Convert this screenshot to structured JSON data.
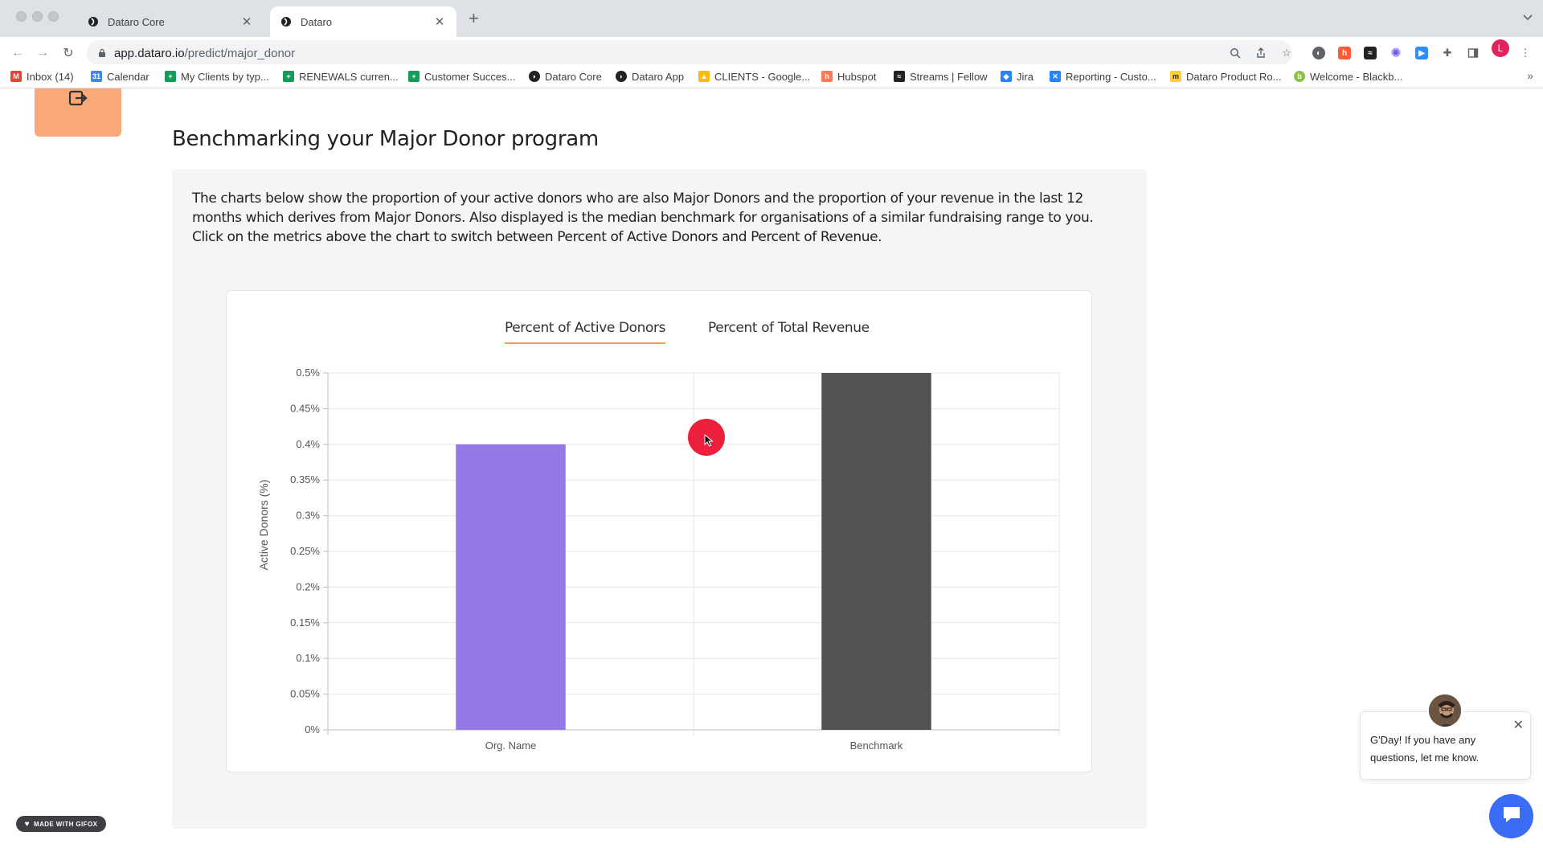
{
  "browser": {
    "tabs": [
      {
        "title": "Dataro Core",
        "active": false
      },
      {
        "title": "Dataro",
        "active": true
      }
    ],
    "url_host": "app.dataro.io",
    "url_path": "/predict/major_donor",
    "profile_initial": "L",
    "bookmarks": [
      {
        "label": "Inbox (14)",
        "icon": "gmail-icon",
        "color": "#ea4335"
      },
      {
        "label": "Calendar",
        "icon": "calendar-icon",
        "color": "#4285f4"
      },
      {
        "label": "My Clients by typ...",
        "icon": "sheets-icon",
        "color": "#0f9d58"
      },
      {
        "label": "RENEWALS curren...",
        "icon": "sheets-icon",
        "color": "#0f9d58"
      },
      {
        "label": "Customer Succes...",
        "icon": "sheets-icon",
        "color": "#0f9d58"
      },
      {
        "label": "Dataro Core",
        "icon": "dataro-icon",
        "color": "#222222"
      },
      {
        "label": "Dataro App",
        "icon": "dataro-icon",
        "color": "#222222"
      },
      {
        "label": "CLIENTS - Google...",
        "icon": "drive-icon",
        "color": "#fbbc04"
      },
      {
        "label": "Hubspot",
        "icon": "hubspot-icon",
        "color": "#ff7a59"
      },
      {
        "label": "Streams | Fellow",
        "icon": "fellow-icon",
        "color": "#222222"
      },
      {
        "label": "Jira",
        "icon": "jira-icon",
        "color": "#2684ff"
      },
      {
        "label": "Reporting - Custo...",
        "icon": "confluence-icon",
        "color": "#2684ff"
      },
      {
        "label": "Dataro Product Ro...",
        "icon": "miro-icon",
        "color": "#ffd02f"
      },
      {
        "label": "Welcome - Blackb...",
        "icon": "blackbaud-icon",
        "color": "#8bc34a"
      }
    ]
  },
  "page": {
    "title": "Benchmarking your Major Donor program",
    "description": "The charts below show the proportion of your active donors who are also Major Donors and the proportion of your revenue in the last 12 months which derives from Major Donors. Also displayed is the median benchmark for organisations of a similar fundraising range to you. Click on the metrics above the chart to switch between Percent of Active Donors and Percent of Revenue.",
    "metric_tabs": [
      {
        "label": "Percent of Active Donors",
        "active": true
      },
      {
        "label": "Percent of Total Revenue",
        "active": false
      }
    ]
  },
  "chart_data": {
    "type": "bar",
    "categories": [
      "Org. Name",
      "Benchmark"
    ],
    "values": [
      0.4,
      0.5
    ],
    "colors": [
      "#9378e6",
      "#535353"
    ],
    "ylabel": "Active Donors (%)",
    "ylim": [
      0,
      0.5
    ],
    "yticks": [
      0,
      0.05,
      0.1,
      0.15,
      0.2,
      0.25,
      0.3,
      0.35,
      0.4,
      0.45,
      0.5
    ],
    "ytick_labels": [
      "0%",
      "0.05%",
      "0.1%",
      "0.15%",
      "0.2%",
      "0.25%",
      "0.3%",
      "0.35%",
      "0.4%",
      "0.45%",
      "0.5%"
    ],
    "grid": true
  },
  "chat": {
    "message": "G'Day! If you have any questions, let me know."
  },
  "watermark": "MADE WITH GIFOX",
  "colors": {
    "accent": "#f39a5c",
    "side_tile": "#f9a977",
    "chat_button": "#3a6cf4"
  }
}
